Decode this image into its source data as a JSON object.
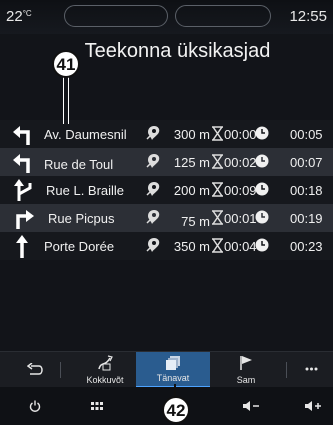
{
  "status_bar": {
    "temperature": "22",
    "temp_unit": "°C",
    "time": "12:55"
  },
  "title": "Teekonna üksikasjad",
  "callouts": {
    "top": "41",
    "bottom": "42"
  },
  "route": [
    {
      "direction": "turn-left-icon",
      "street": "Av. Daumesnil",
      "distance": "300 m",
      "duration": "00:00",
      "eta": "00:05"
    },
    {
      "direction": "turn-left-icon",
      "street": "Rue de Toul",
      "distance": "125 m",
      "duration": "00:02",
      "eta": "00:07"
    },
    {
      "direction": "fork-left-icon",
      "street": "Rue L. Braille",
      "distance": "200 m",
      "duration": "00:09",
      "eta": "00:18"
    },
    {
      "direction": "turn-right-icon",
      "street": "Rue Picpus",
      "distance": "75 m",
      "duration": "00:01",
      "eta": "00:19"
    },
    {
      "direction": "straight-icon",
      "street": "Porte Dorée",
      "distance": "350 m",
      "duration": "00:04",
      "eta": "00:23"
    }
  ],
  "tabs": {
    "summary": "Kokkuvõt",
    "streets": "Tänavat",
    "steps": "Sam"
  },
  "colors": {
    "background": "#121419",
    "row_alt": "#2c2f36",
    "active_tab": "#2a5c8f",
    "accent": "#4da3ff"
  }
}
